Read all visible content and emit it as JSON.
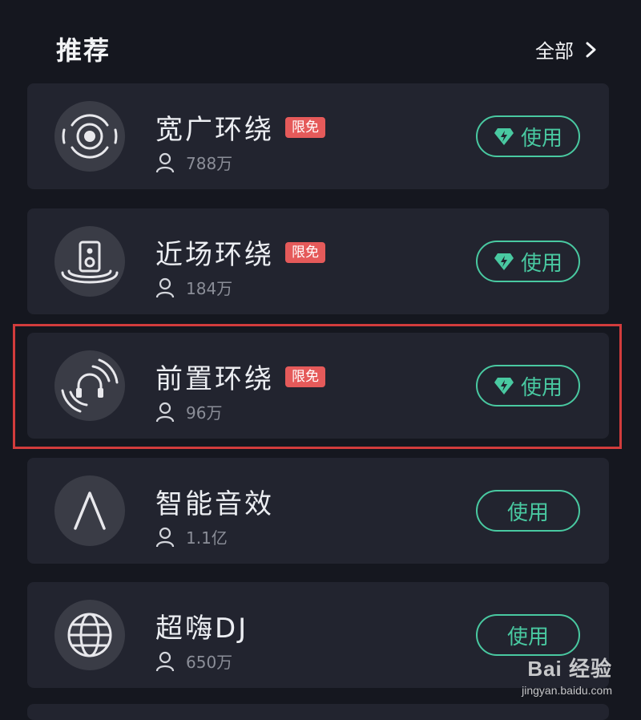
{
  "header": {
    "title": "推荐",
    "all_label": "全部"
  },
  "colors": {
    "accent": "#49c9a1",
    "badge": "#e55a5a",
    "card_bg": "#22242f",
    "page_bg": "#15171f",
    "highlight": "#d23c3c"
  },
  "items": [
    {
      "name": "宽广环绕",
      "badge": "限免",
      "users": "788万",
      "button": "使用",
      "premium": true,
      "icon": "surround-wide-icon"
    },
    {
      "name": "近场环绕",
      "badge": "限免",
      "users": "184万",
      "button": "使用",
      "premium": true,
      "icon": "speaker-nearfield-icon"
    },
    {
      "name": "前置环绕",
      "badge": "限免",
      "users": "96万",
      "button": "使用",
      "premium": true,
      "icon": "headphone-surround-icon"
    },
    {
      "name": "智能音效",
      "users": "1.1亿",
      "button": "使用",
      "premium": false,
      "icon": "smart-a-icon"
    },
    {
      "name": "超嗨DJ",
      "users": "650万",
      "button": "使用",
      "premium": false,
      "icon": "globe-icon"
    }
  ],
  "watermark": {
    "main": "Bai  经验",
    "sub": "jingyan.baidu.com"
  }
}
